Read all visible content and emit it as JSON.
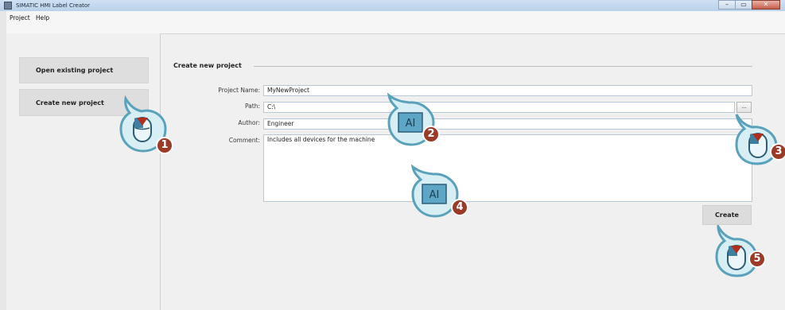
{
  "window": {
    "title": "SIMATIC HMI Label Creator",
    "buttons": {
      "minimize": "–",
      "maximize": "▭",
      "close": "✕"
    }
  },
  "menu": {
    "items": [
      "Project",
      "Help"
    ]
  },
  "sidebar": {
    "open_label": "Open existing project",
    "create_label": "Create new project"
  },
  "form": {
    "section_title": "Create new project",
    "project_name": {
      "label": "Project Name:",
      "value": "MyNewProject"
    },
    "path": {
      "label": "Path:",
      "value": "C:\\"
    },
    "browse_label": "...",
    "author": {
      "label": "Author:",
      "value": "Engineer"
    },
    "comment": {
      "label": "Comment:",
      "value": "Includes all devices for the machine"
    },
    "create_label": "Create"
  },
  "callouts": [
    {
      "number": "1",
      "icon": "mouse-click-icon"
    },
    {
      "number": "2",
      "icon": "text-input-icon"
    },
    {
      "number": "3",
      "icon": "mouse-click-icon"
    },
    {
      "number": "4",
      "icon": "text-input-icon"
    },
    {
      "number": "5",
      "icon": "mouse-click-icon"
    }
  ],
  "colors": {
    "callout_fill": "#d6eef4",
    "callout_stroke": "#5aa1bb",
    "badge": "#9b3a26",
    "pointer": "#b22d1b"
  }
}
